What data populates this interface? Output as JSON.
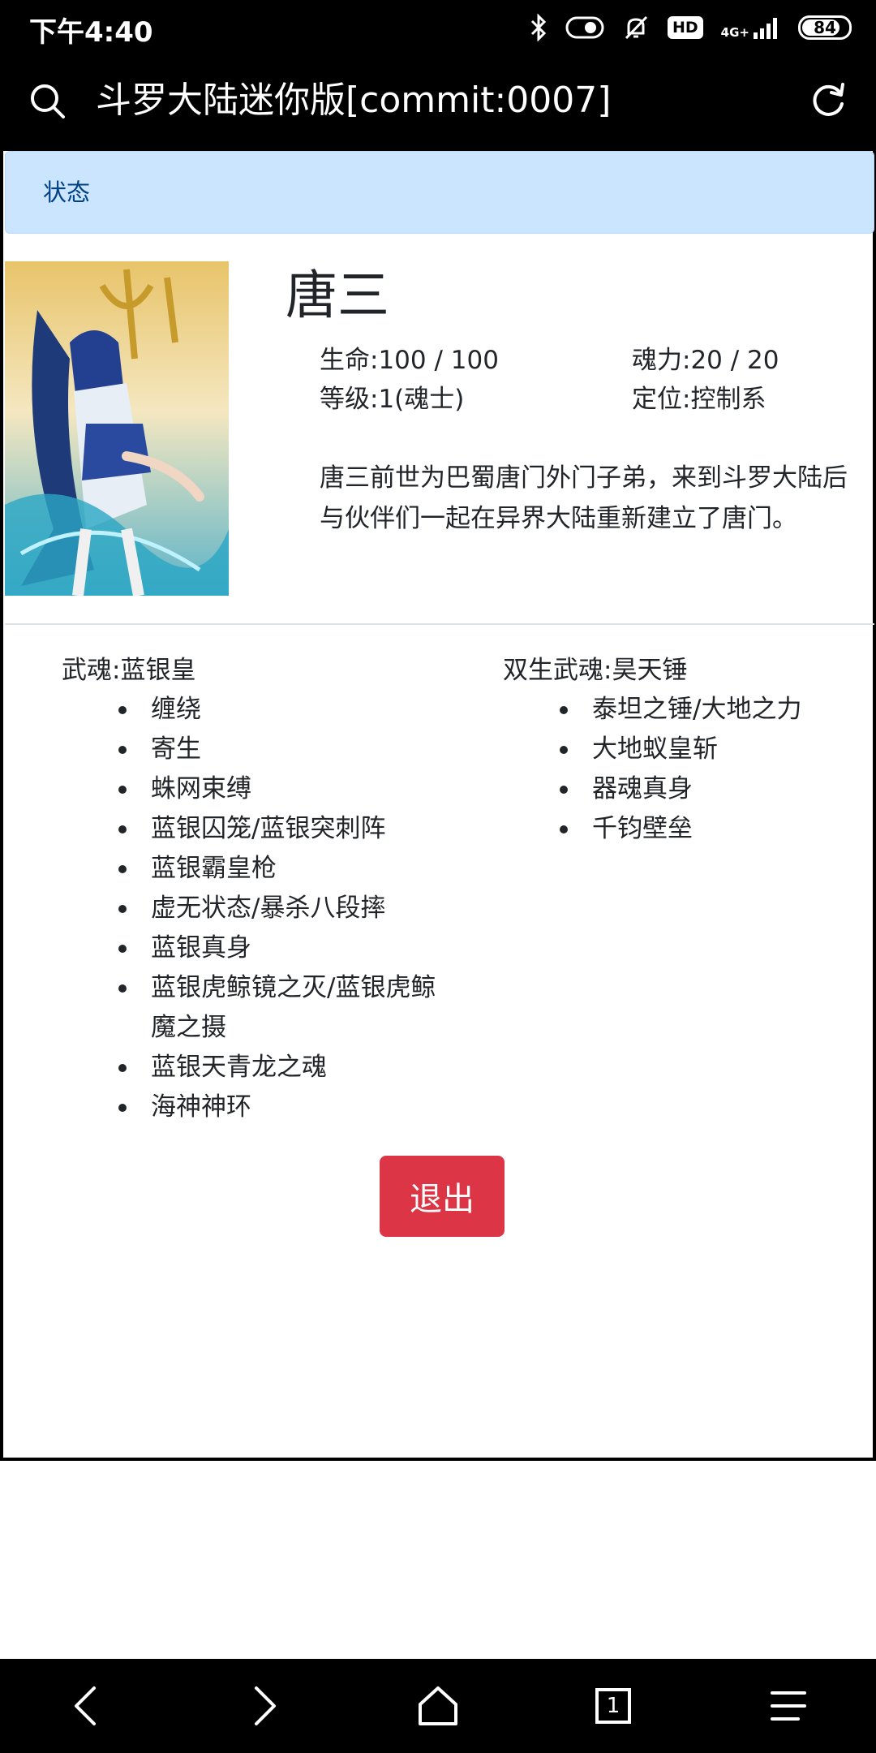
{
  "status_bar": {
    "time": "下午4:40",
    "network": "4G+",
    "hd_badge": "HD",
    "battery": "84",
    "battery_fraction": 0.84
  },
  "toolbar": {
    "title": "斗罗大陆迷你版[commit:0007]",
    "search_icon": "search-icon",
    "refresh_icon": "refresh-icon"
  },
  "alert": {
    "text": "状态"
  },
  "character": {
    "name": "唐三",
    "hp": "生命:100 / 100",
    "soul_power": "魂力:20 / 20",
    "level": "等级:1(魂士)",
    "role": "定位:控制系",
    "description": "唐三前世为巴蜀唐门外门子弟，来到斗罗大陆后与伙伴们一起在异界大陆重新建立了唐门。"
  },
  "martial_souls": [
    {
      "title": "武魂:蓝银皇",
      "skills": [
        "缠绕",
        "寄生",
        "蛛网束缚",
        "蓝银囚笼/蓝银突刺阵",
        "蓝银霸皇枪",
        "虚无状态/暴杀八段摔",
        "蓝银真身",
        "蓝银虎鲸镜之灭/蓝银虎鲸魔之摄",
        "蓝银天青龙之魂",
        "海神神环"
      ]
    },
    {
      "title": "双生武魂:昊天锤",
      "skills": [
        "泰坦之锤/大地之力",
        "大地蚁皇斩",
        "器魂真身",
        "千钧壁垒"
      ]
    }
  ],
  "exit_button": {
    "label": "退出",
    "color": "#dc3545"
  },
  "nav_bar": {
    "tab_count": "1"
  },
  "colors": {
    "alert_bg": "#cce5ff",
    "alert_text": "#004085",
    "danger": "#dc3545"
  }
}
